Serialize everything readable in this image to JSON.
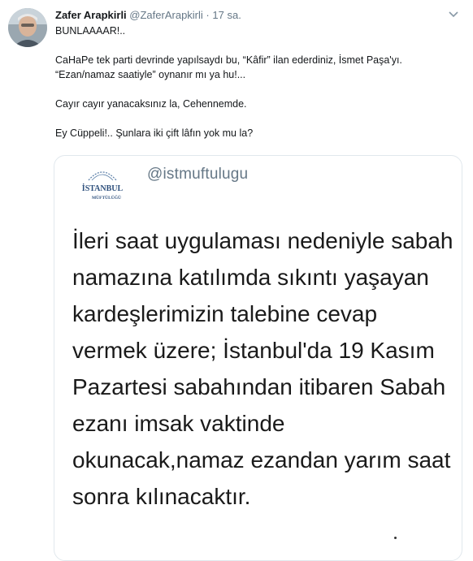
{
  "tweet": {
    "author_name": "Zafer Arapkirli",
    "handle": "@ZaferArapkirli",
    "separator": "·",
    "time": "17 sa.",
    "paragraphs": [
      "BUNLAAAAR!..",
      "CaHaPe tek parti devrinde yapılsaydı bu, “Kâfir” ilan ederdiniz, İsmet Paşa'yı. “Ezan/namaz saatiyle” oynanır mı ya hu!...",
      "Cayır cayır yanacaksınız la, Cehennemde.",
      "Ey Cüppeli!.. Şunlara iki çift lâfın yok mu la?"
    ]
  },
  "quote": {
    "logo_text_top": "İSTANBUL",
    "logo_text_bottom": "MÜFTÜLÜĞÜ",
    "handle": "@istmuftulugu",
    "body": "İleri saat uygulaması nedeniyle sabah namazına katılımda sıkıntı yaşayan kardeşlerimizin talebine cevap vermek üzere; İstanbul'da 19 Kasım Pazartesi sabahından itibaren Sabah ezanı imsak vaktinde okunacak,namaz ezandan yarım saat sonra kılınacaktır."
  },
  "icons": {
    "chevron": "chevron-down-icon",
    "avatar": "avatar"
  },
  "colors": {
    "text": "#14171a",
    "secondary": "#657786",
    "border": "#e1e8ed"
  }
}
